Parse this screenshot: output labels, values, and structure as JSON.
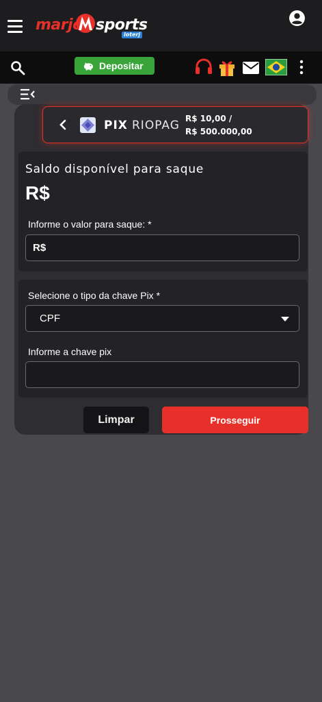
{
  "header": {
    "logo": {
      "part1": "marjo",
      "part2": "sports",
      "badge": "loterj"
    },
    "icons": [
      "menu-icon",
      "account-icon"
    ]
  },
  "toolbar": {
    "deposit_label": "Depositar",
    "icons": [
      "search-icon",
      "piggy-bank-icon",
      "headset-icon",
      "gift-icon",
      "mail-icon",
      "brazil-flag-icon",
      "more-vertical-icon"
    ]
  },
  "method": {
    "name": "PIX",
    "provider": "RIOPAG",
    "min": "R$ 10,00 /",
    "max": "R$ 500.000,00"
  },
  "balance": {
    "title": "Saldo disponível para saque",
    "value": "R$"
  },
  "amount": {
    "label": "Informe o valor para saque: *",
    "value": "R$"
  },
  "pix_key_type": {
    "label": "Selecione o tipo da chave Pix *",
    "selected": "CPF"
  },
  "pix_key": {
    "label": "Informe a chave pix",
    "value": ""
  },
  "actions": {
    "clear": "Limpar",
    "proceed": "Prosseguir"
  },
  "colors": {
    "accent": "#e8302a",
    "deposit": "#38a43a",
    "background": "#49484d"
  }
}
